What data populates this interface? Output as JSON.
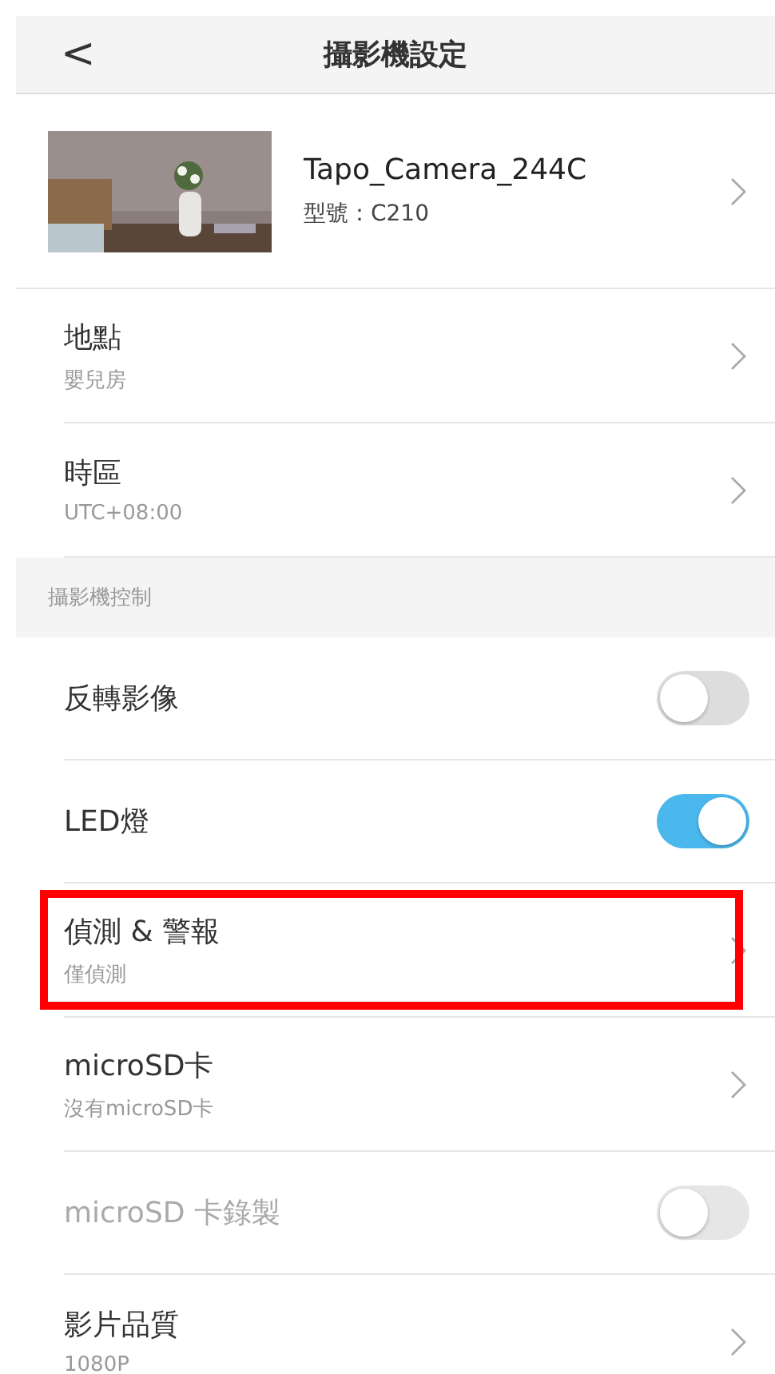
{
  "header": {
    "back": "<",
    "title": "攝影機設定"
  },
  "camera": {
    "name": "Tapo_Camera_244C",
    "model": "型號：C210"
  },
  "sections": [
    {
      "rows": [
        {
          "kind": "link",
          "label": "地點",
          "value": "嬰兒房",
          "highlighted": false
        },
        {
          "kind": "link",
          "label": "時區",
          "value": "UTC+08:00",
          "highlighted": false
        }
      ]
    },
    {
      "title": "攝影機控制",
      "rows": [
        {
          "kind": "toggle",
          "label": "反轉影像",
          "on": false,
          "disabled": false,
          "highlighted": false
        },
        {
          "kind": "toggle",
          "label": "LED燈",
          "on": true,
          "disabled": false,
          "highlighted": false
        },
        {
          "kind": "link",
          "label": "偵測 & 警報",
          "value": "僅偵測",
          "highlighted": true
        },
        {
          "kind": "link",
          "label": "microSD卡",
          "value": "沒有microSD卡",
          "highlighted": false
        },
        {
          "kind": "toggle",
          "label": "microSD 卡錄製",
          "on": false,
          "disabled": true,
          "highlighted": false
        },
        {
          "kind": "link",
          "label": "影片品質",
          "value": "1080P",
          "highlighted": false
        }
      ]
    }
  ]
}
